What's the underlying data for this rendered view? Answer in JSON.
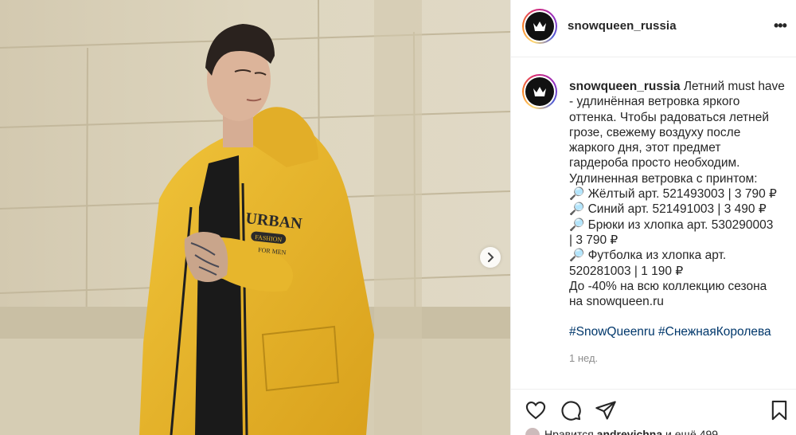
{
  "post": {
    "author": "snowqueen_russia",
    "more_label": "•••",
    "caption_lines": [
      "Летний must have",
      "- удлинённая ветровка яркого",
      "оттенка. Чтобы радоваться летней",
      "грозе, свежему воздуху после",
      "жаркого дня, этот предмет",
      "гардероба просто необходим.",
      "Удлиненная ветровка с принтом:",
      "🔎 Жёлтый арт. 521493003 | 3 790 ₽",
      "🔎 Синий арт. 521491003 | 3 490 ₽",
      "🔎 Брюки из хлопка арт. 530290003",
      "| 3 790 ₽",
      "🔎 Футболка из хлопка арт.",
      "520281003 | 1 190 ₽",
      "До -40% на всю коллекцию сезона",
      "на snowqueen.ru"
    ],
    "hashtags": "#SnowQueenru #СнежнаяКоролева",
    "time_ago": "1 нед.",
    "likes_prefix": "Нравится",
    "likes_user": "andrevichna",
    "likes_suffix": "и ещё 499"
  },
  "jacket_print": {
    "line1": "URBAN",
    "line2": "FASHION",
    "line3": "FOR MEN"
  },
  "icons": {
    "avatar": "crown-icon",
    "next": "chevron-right-icon",
    "like": "heart-icon",
    "comment": "comment-icon",
    "share": "paper-plane-icon",
    "save": "bookmark-icon"
  },
  "colors": {
    "jacket": "#e8b72a",
    "wall": "#d8cfb6",
    "hashtag": "#00376b",
    "muted": "#8e8e8e",
    "text": "#262626"
  }
}
